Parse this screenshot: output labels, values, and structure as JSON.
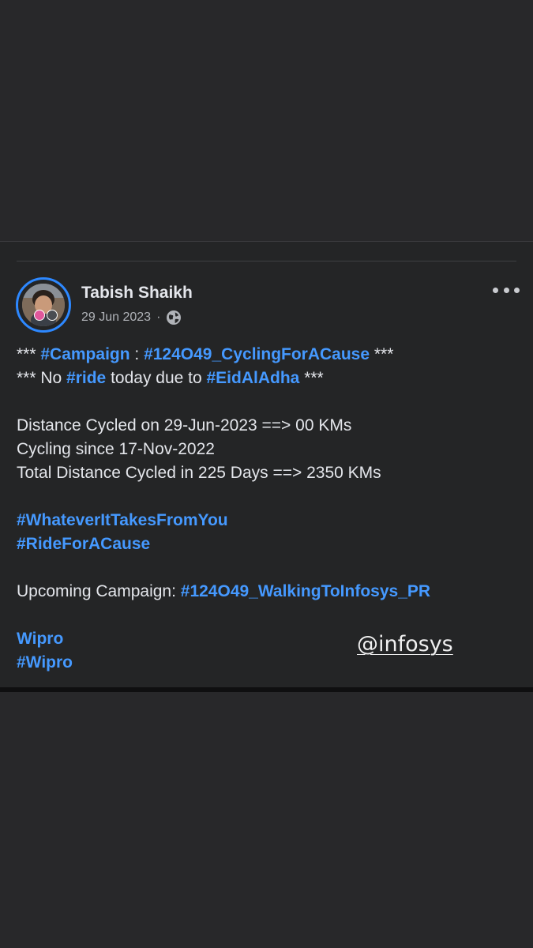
{
  "post": {
    "author_name": "Tabish Shaikh",
    "date": "29 Jun 2023",
    "separator": "·",
    "privacy_icon": "globe-icon",
    "menu_icon": "more-horizontal-icon",
    "body": {
      "l1_a": "*** ",
      "l1_tag1": "#Campaign",
      "l1_b": " : ",
      "l1_tag2": "#124O49_CyclingForACause",
      "l1_c": " ***",
      "l2_a": "*** No ",
      "l2_tag1": "#ride",
      "l2_b": " today due to ",
      "l2_tag2": "#EidAlAdha",
      "l2_c": " ***",
      "l3": "Distance Cycled on 29-Jun-2023 ==> 00 KMs",
      "l4": "Cycling since 17-Nov-2022",
      "l5": "Total Distance Cycled in 225 Days ==> 2350 KMs",
      "tag_whatever": "#WhateverItTakesFromYou",
      "tag_ride": "#RideForACause",
      "upcoming_label": "Upcoming Campaign: ",
      "upcoming_tag": "#124O49_WalkingToInfosys_PR",
      "mention_wipro": "Wipro",
      "tag_wipro": "#Wipro"
    },
    "watermark": "@infosys"
  },
  "colors": {
    "background": "#28282a",
    "card": "#242526",
    "link": "#4599ff",
    "text": "#e4e6eb",
    "muted": "#b0b3b8",
    "avatar_ring": "#2d88ff"
  }
}
